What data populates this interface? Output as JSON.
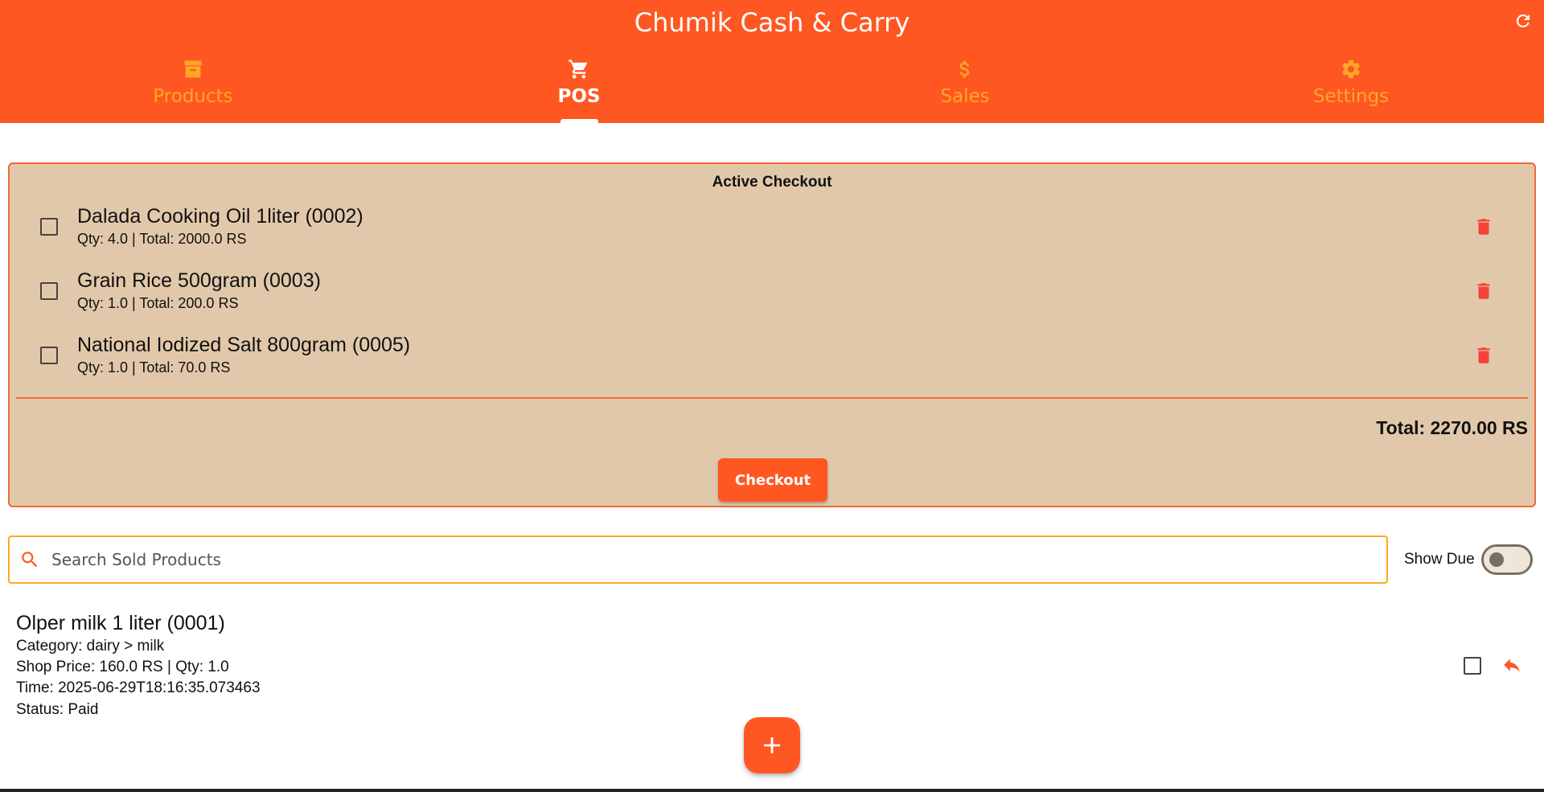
{
  "app": {
    "title": "Chumik Cash & Carry",
    "accent_color": "#FF5722",
    "tab_inactive_color": "#FFA726",
    "refresh_icon": "refresh-icon"
  },
  "tabs": [
    {
      "label": "Products",
      "icon": "archive-box-icon",
      "active": false
    },
    {
      "label": "POS",
      "icon": "shopping-cart-icon",
      "active": true
    },
    {
      "label": "Sales",
      "icon": "dollar-icon",
      "active": false
    },
    {
      "label": "Settings",
      "icon": "gear-icon",
      "active": false
    }
  ],
  "checkout": {
    "title": "Active Checkout",
    "panel_color": "#E2C8AA",
    "items": [
      {
        "name": "Dalada Cooking Oil 1liter (0002)",
        "meta": "Qty: 4.0 | Total: 2000.0 RS",
        "checked": false
      },
      {
        "name": "Grain Rice 500gram (0003)",
        "meta": "Qty: 1.0 | Total: 200.0 RS",
        "checked": false
      },
      {
        "name": "National Iodized Salt 800gram (0005)",
        "meta": "Qty: 1.0 | Total: 70.0 RS",
        "checked": false
      }
    ],
    "total": "Total: 2270.00 RS",
    "checkout_label": "Checkout"
  },
  "search": {
    "placeholder": "Search Sold Products",
    "value": ""
  },
  "show_due": {
    "label": "Show Due",
    "enabled": false
  },
  "sold": [
    {
      "name": "Olper milk 1 liter (0001)",
      "category": "Category: dairy > milk",
      "price_qty": "Shop Price: 160.0 RS | Qty: 1.0",
      "time": "Time: 2025-06-29T18:16:35.073463",
      "status": "Status: Paid"
    }
  ],
  "fab": {
    "icon": "plus-icon"
  }
}
